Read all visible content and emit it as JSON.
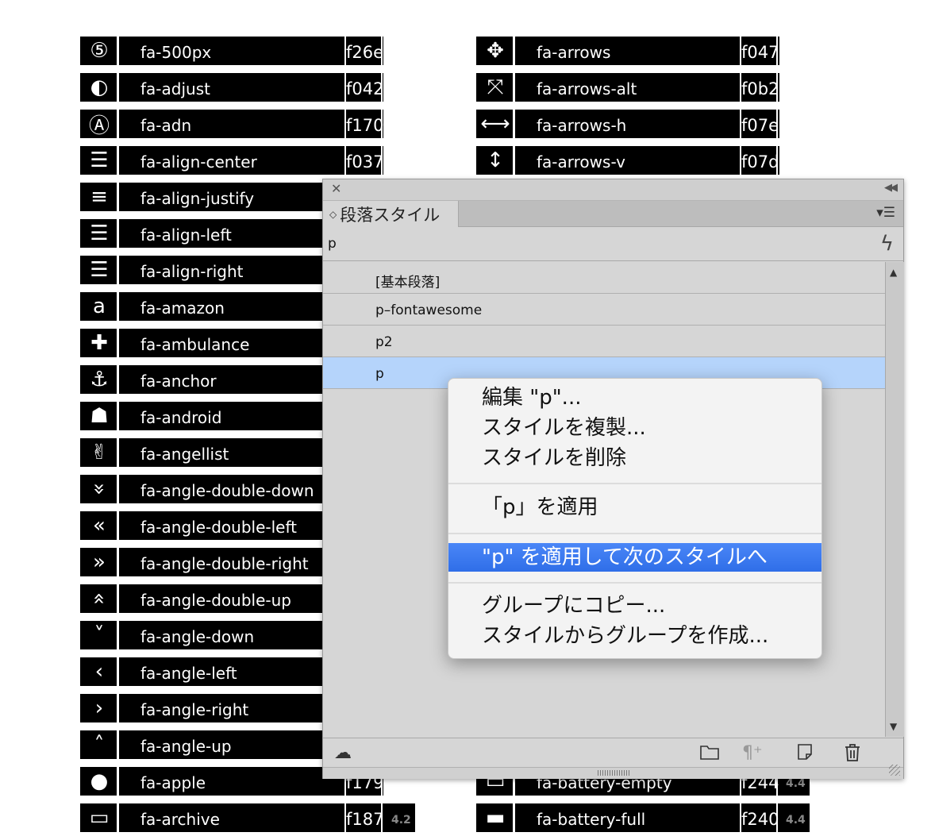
{
  "left_icons": [
    {
      "name": "fa-500px",
      "code": "f26e",
      "icon": "500px-icon"
    },
    {
      "name": "fa-adjust",
      "code": "f042",
      "icon": "adjust-icon"
    },
    {
      "name": "fa-adn",
      "code": "f170",
      "icon": "adn-icon"
    },
    {
      "name": "fa-align-center",
      "code": "f037",
      "icon": "align-center-icon"
    },
    {
      "name": "fa-align-justify",
      "code": "",
      "icon": "align-justify-icon"
    },
    {
      "name": "fa-align-left",
      "code": "",
      "icon": "align-left-icon"
    },
    {
      "name": "fa-align-right",
      "code": "",
      "icon": "align-right-icon"
    },
    {
      "name": "fa-amazon",
      "code": "",
      "icon": "amazon-icon"
    },
    {
      "name": "fa-ambulance",
      "code": "",
      "icon": "ambulance-icon"
    },
    {
      "name": "fa-anchor",
      "code": "",
      "icon": "anchor-icon"
    },
    {
      "name": "fa-android",
      "code": "",
      "icon": "android-icon"
    },
    {
      "name": "fa-angellist",
      "code": "",
      "icon": "angellist-icon"
    },
    {
      "name": "fa-angle-double-down",
      "code": "",
      "icon": "angle-double-down-icon"
    },
    {
      "name": "fa-angle-double-left",
      "code": "",
      "icon": "angle-double-left-icon"
    },
    {
      "name": "fa-angle-double-right",
      "code": "",
      "icon": "angle-double-right-icon"
    },
    {
      "name": "fa-angle-double-up",
      "code": "",
      "icon": "angle-double-up-icon"
    },
    {
      "name": "fa-angle-down",
      "code": "",
      "icon": "angle-down-icon"
    },
    {
      "name": "fa-angle-left",
      "code": "",
      "icon": "angle-left-icon"
    },
    {
      "name": "fa-angle-right",
      "code": "",
      "icon": "angle-right-icon"
    },
    {
      "name": "fa-angle-up",
      "code": "",
      "icon": "angle-up-icon"
    },
    {
      "name": "fa-apple",
      "code": "f179",
      "icon": "apple-icon"
    },
    {
      "name": "fa-archive",
      "code": "f187",
      "version": "4.2",
      "icon": "archive-icon"
    }
  ],
  "right_icons": [
    {
      "name": "fa-arrows",
      "code": "f047",
      "icon": "arrows-icon"
    },
    {
      "name": "fa-arrows-alt",
      "code": "f0b2",
      "icon": "arrows-alt-icon"
    },
    {
      "name": "fa-arrows-h",
      "code": "f07e",
      "icon": "arrows-h-icon"
    },
    {
      "name": "fa-arrows-v",
      "code": "f07d",
      "icon": "arrows-v-icon"
    },
    {
      "name": "fa-battery-empty",
      "code": "f244",
      "version": "4.4",
      "icon": "battery-empty-icon"
    },
    {
      "name": "fa-battery-full",
      "code": "f240",
      "version": "4.4",
      "icon": "battery-full-icon"
    }
  ],
  "panel": {
    "tab_label": "段落スタイル",
    "search_value": "p",
    "styles": [
      "[基本段落]",
      "p–fontawesome",
      "p2",
      "p"
    ],
    "selected_index": 3
  },
  "context_menu": {
    "items": [
      "編集 \"p\"...",
      "スタイルを複製...",
      "スタイルを削除",
      "「p」を適用",
      "\"p\" を適用して次のスタイルへ",
      "グループにコピー...",
      "スタイルからグループを作成..."
    ],
    "highlighted_index": 4
  },
  "colors": {
    "selection": "#b5d4fb",
    "menu_highlight": "#3478f6",
    "panel_bg": "#d6d6d6"
  }
}
